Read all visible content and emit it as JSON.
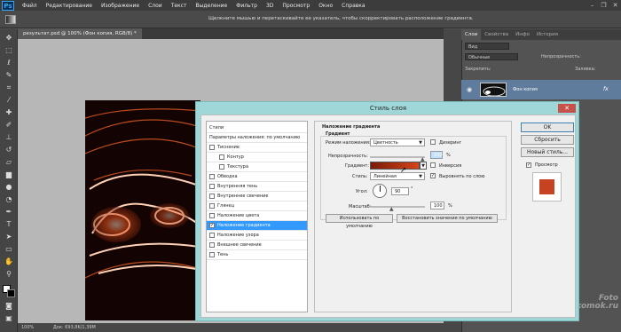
{
  "app": {
    "logo": "Ps"
  },
  "menu": [
    "Файл",
    "Редактирование",
    "Изображение",
    "Слои",
    "Текст",
    "Выделение",
    "Фильтр",
    "3D",
    "Просмотр",
    "Окно",
    "Справка"
  ],
  "window_controls": [
    "–",
    "❐",
    "✕"
  ],
  "options_hint": "Щелкните мышью и перетаскивайте ее указатель, чтобы скорректировать расположение градиента.",
  "document": {
    "tab": "результат.psd @ 100% (Фон копия, RGB/8) *",
    "zoom": "100%",
    "status": "Док: 693,8K/1,39M"
  },
  "layers_panel": {
    "tabs": [
      "Слои",
      "Свойства",
      "Инфо",
      "История"
    ],
    "kind_label": "Вид",
    "blend": "Обычные",
    "opacity_label": "Непрозрачность:",
    "lock_label": "Закрепить:",
    "fill_label": "Заливка:",
    "layer_name": "Фон копия",
    "fx": "fx"
  },
  "dialog": {
    "title": "Стиль слоя",
    "close": "✕",
    "styles": [
      {
        "label": "Стили",
        "check": false,
        "indent": false,
        "selected": false,
        "checked": false
      },
      {
        "label": "Параметры наложения: по умолчанию",
        "check": false,
        "indent": false,
        "selected": false,
        "checked": false
      },
      {
        "label": "Тиснение",
        "check": true,
        "indent": false,
        "selected": false,
        "checked": false
      },
      {
        "label": "Контур",
        "check": true,
        "indent": true,
        "selected": false,
        "checked": false
      },
      {
        "label": "Текстура",
        "check": true,
        "indent": true,
        "selected": false,
        "checked": false
      },
      {
        "label": "Обводка",
        "check": true,
        "indent": false,
        "selected": false,
        "checked": false
      },
      {
        "label": "Внутренняя тень",
        "check": true,
        "indent": false,
        "selected": false,
        "checked": false
      },
      {
        "label": "Внутреннее свечение",
        "check": true,
        "indent": false,
        "selected": false,
        "checked": false
      },
      {
        "label": "Глянец",
        "check": true,
        "indent": false,
        "selected": false,
        "checked": false
      },
      {
        "label": "Наложение цвета",
        "check": true,
        "indent": false,
        "selected": false,
        "checked": false
      },
      {
        "label": "Наложение градиента",
        "check": true,
        "indent": false,
        "selected": true,
        "checked": true
      },
      {
        "label": "Наложение узора",
        "check": true,
        "indent": false,
        "selected": false,
        "checked": false
      },
      {
        "label": "Внешнее свечение",
        "check": true,
        "indent": false,
        "selected": false,
        "checked": false
      },
      {
        "label": "Тень",
        "check": true,
        "indent": false,
        "selected": false,
        "checked": false
      }
    ],
    "section_title": "Наложение градиента",
    "group_title": "Градиент",
    "blend_label": "Режим наложения:",
    "blend_value": "Цветность",
    "dither_label": "Дизеринг",
    "opacity_label": "Непрозрачность:",
    "opacity_value": "100",
    "percent": "%",
    "gradient_label": "Градиент:",
    "invert_label": "Инверсия",
    "style_label": "Стиль:",
    "style_value": "Линейная",
    "align_label": "Выровнять по слою",
    "angle_label": "Угол:",
    "angle_value": "90",
    "degree": "°",
    "scale_label": "Масштаб:",
    "scale_value": "100",
    "default_btn": "Использовать по умолчанию",
    "restore_btn": "Восстановить значения по умолчанию",
    "ok": "OK",
    "reset": "Сбросить",
    "new_style": "Новый стиль...",
    "preview_label": "Просмотр"
  },
  "watermark": [
    "Foto",
    "komok.ru"
  ],
  "colors": {
    "gradient_start": "#7a1a06",
    "gradient_end": "#d4451a",
    "preview_swatch": "#c64220",
    "dialog_frame": "#9fd7d9",
    "selection": "#3399ff"
  }
}
